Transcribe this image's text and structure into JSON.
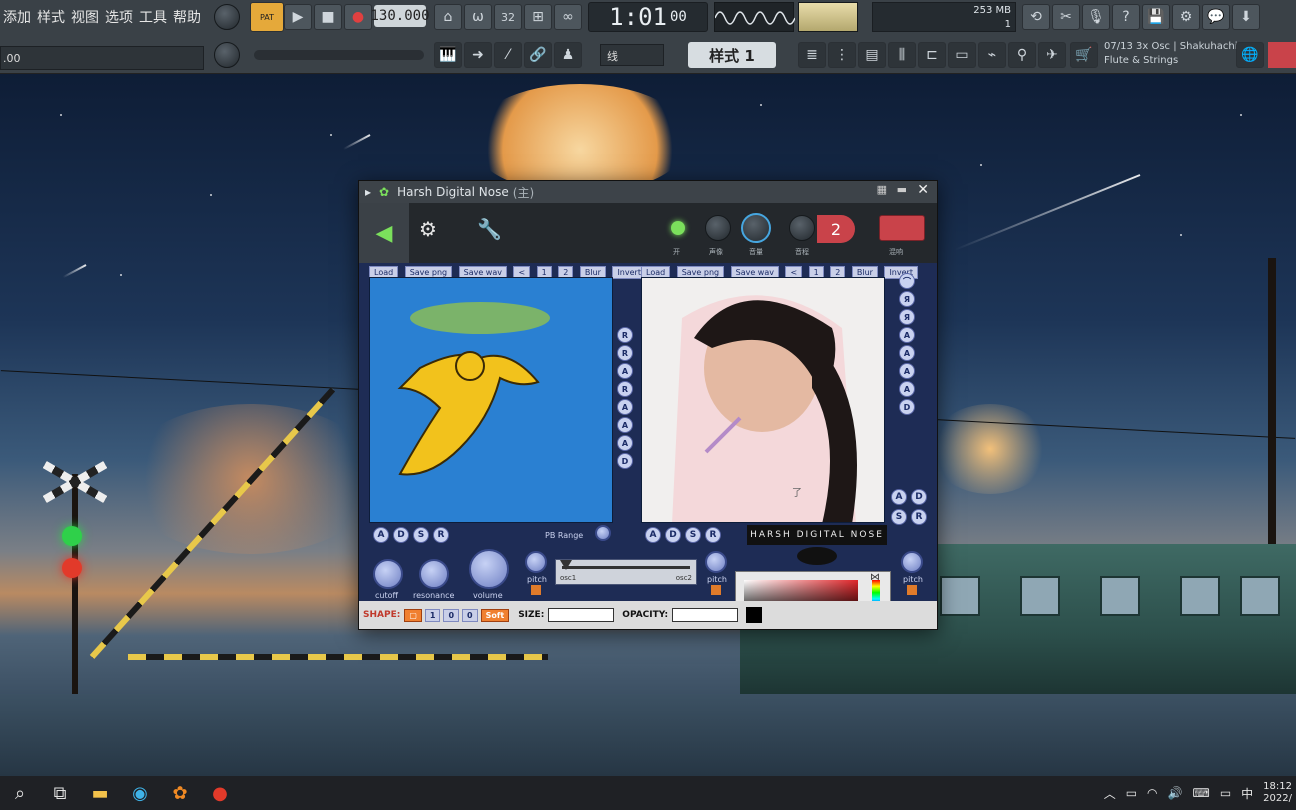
{
  "menu": {
    "items": [
      "添加",
      "样式",
      "视图",
      "选项",
      "工具",
      "帮助"
    ]
  },
  "transport": {
    "pat_label": "PAT",
    "tempo": "130.000",
    "time": "1:01",
    "time_fraction": "00",
    "beat_label": "32"
  },
  "toolbar": {
    "left_value": ".00",
    "snap_value": "线",
    "pattern_label": "样式 1",
    "cpu_mem": "253 MB",
    "cpu_voices": "1"
  },
  "hint": {
    "line1": "07/13  3x Osc | Shakuhachi",
    "line2": "Flute & Strings"
  },
  "plugin": {
    "title": "Harsh Digital Nose",
    "title_suffix": "(主)",
    "header_labels": [
      "开",
      "声像",
      "音量",
      "音程",
      "混响"
    ],
    "mixer_track": "2",
    "left_panel_buttons": [
      "Load",
      "Save png",
      "Save wav",
      "<",
      "1",
      "2",
      "Blur",
      "Invert"
    ],
    "right_panel_buttons": [
      "Load",
      "Save png",
      "Save wav",
      "<",
      "1",
      "2",
      "Blur",
      "Invert"
    ],
    "adsr": [
      "A",
      "D",
      "S",
      "R"
    ],
    "pb_range_label": "PB Range",
    "knob_labels": [
      "cutoff",
      "resonance",
      "volume"
    ],
    "pitch_label": "pitch",
    "osc_labels": [
      "osc1",
      "osc2"
    ],
    "logo_text": "HARSH DIGITAL NOSE",
    "bottom": {
      "shape_label": "SHAPE:",
      "shape_buttons": [
        "▢",
        "1",
        "0",
        "0"
      ],
      "soft_label": "Soft",
      "size_label": "SIZE:",
      "opacity_label": "OPACITY:"
    },
    "caption_text": "了"
  },
  "taskbar": {
    "clock_time": "18:12",
    "clock_date": "2022/",
    "ime": "中"
  },
  "colors": {
    "fl_bg": "#3a4147",
    "plugin_body": "#1e2c55",
    "accent_red": "#c9434a",
    "accent_green": "#7be05c"
  }
}
